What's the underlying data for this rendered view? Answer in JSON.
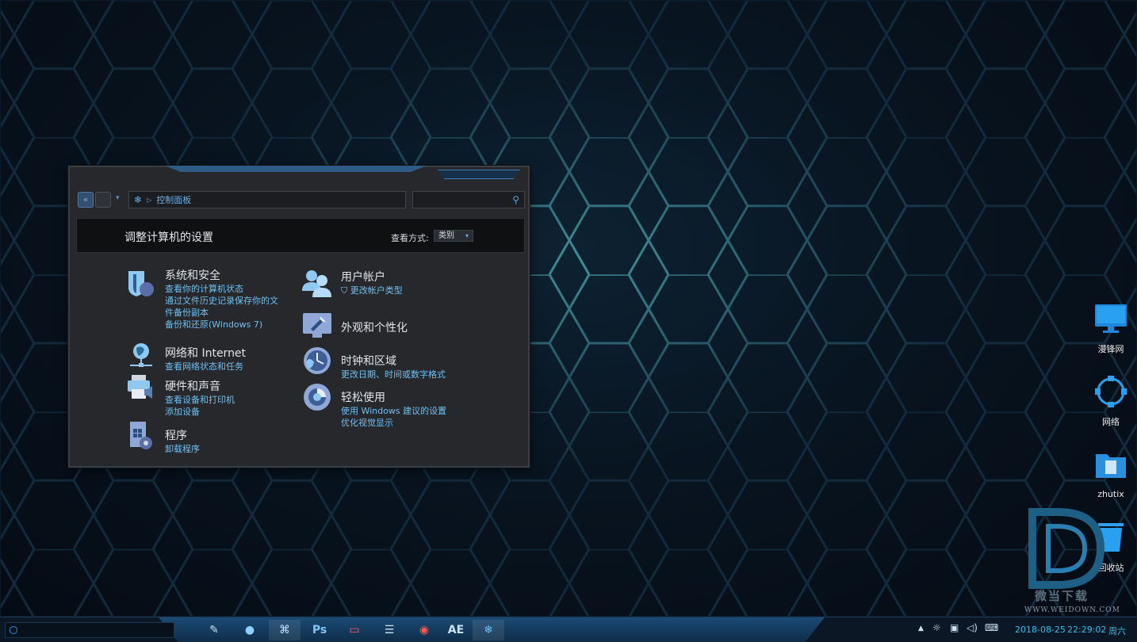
{
  "window": {
    "breadcrumb": "控制面板",
    "header_title": "调整计算机的设置",
    "view_by_label": "查看方式:",
    "view_by_value": "类别"
  },
  "categories": {
    "system_security": {
      "title": "系统和安全",
      "links": [
        "查看你的计算机状态",
        "通过文件历史记录保存你的文",
        "件备份副本",
        "备份和还原(Windows 7)"
      ]
    },
    "network": {
      "title": "网络和 Internet",
      "links": [
        "查看网络状态和任务"
      ]
    },
    "hardware": {
      "title": "硬件和声音",
      "links": [
        "查看设备和打印机",
        "添加设备"
      ]
    },
    "programs": {
      "title": "程序",
      "links": [
        "卸载程序"
      ]
    },
    "user_accounts": {
      "title": "用户帐户",
      "links": [
        "更改帐户类型"
      ]
    },
    "appearance": {
      "title": "外观和个性化",
      "links": []
    },
    "clock_region": {
      "title": "时钟和区域",
      "links": [
        "更改日期、时间或数字格式"
      ]
    },
    "ease_access": {
      "title": "轻松使用",
      "links": [
        "使用 Windows 建议的设置",
        "优化视觉显示"
      ]
    }
  },
  "desktop_icons": [
    "漫锋网",
    "网络",
    "zhutix",
    "回收站"
  ],
  "watermark": {
    "text": "微当下载",
    "url": "WWW.WEIDOWN.COM"
  },
  "taskbar": {
    "apps": [
      "pen-icon",
      "chat-icon",
      "gamepad-icon",
      "Ps",
      "monitor-icon",
      "notepad-icon",
      "firefox-icon",
      "AE",
      "settings-icon"
    ],
    "ps_label": "Ps",
    "ae_label": "AE",
    "date": "2018-08-25",
    "time": "22:29:02",
    "weekday": "周六"
  },
  "colors": {
    "accent": "#6ec0f2",
    "window_bg": "#26282c",
    "taskbar_center": "#1a4a74",
    "clock": "#33c0ee"
  }
}
